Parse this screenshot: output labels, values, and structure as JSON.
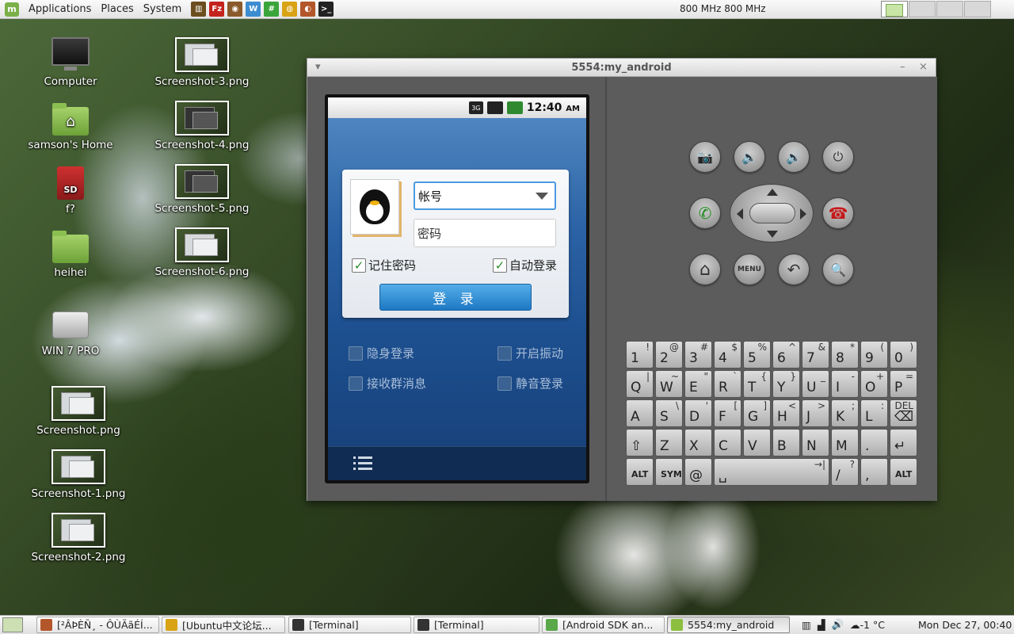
{
  "top_panel": {
    "menus": [
      "Applications",
      "Places",
      "System"
    ],
    "launchers": [
      {
        "icon": "system-monitor-icon",
        "color": "#6b4d1e",
        "glyph": "▥"
      },
      {
        "icon": "filezilla-icon",
        "color": "#c4231d",
        "glyph": "Fz"
      },
      {
        "icon": "disk-utility-icon",
        "color": "#8a5a2a",
        "glyph": "◉"
      },
      {
        "icon": "writer-icon",
        "color": "#3d8dd0",
        "glyph": "W"
      },
      {
        "icon": "calc-icon",
        "color": "#3aa53a",
        "glyph": "#"
      },
      {
        "icon": "chrome-icon",
        "color": "#d9a316",
        "glyph": "◍"
      },
      {
        "icon": "media-icon",
        "color": "#b3572b",
        "glyph": "◐"
      },
      {
        "icon": "terminal-icon",
        "color": "#222222",
        "glyph": ">_"
      }
    ],
    "cpu_freq": "800 MHz  800 MHz"
  },
  "desktop_icons": [
    {
      "label": "Computer",
      "icon": "computer-icon"
    },
    {
      "label": "samson's Home",
      "icon": "home-folder-icon"
    },
    {
      "label": "f?",
      "icon": "sd-card-icon",
      "badge": "SD"
    },
    {
      "label": "heihei",
      "icon": "folder-icon"
    },
    {
      "label": "WIN 7 PRO",
      "icon": "drive-icon"
    },
    {
      "label": "Screenshot.png",
      "icon": "image-thumbnail-icon"
    },
    {
      "label": "Screenshot-1.png",
      "icon": "image-thumbnail-icon"
    },
    {
      "label": "Screenshot-2.png",
      "icon": "image-thumbnail-icon"
    },
    {
      "label": "Screenshot-3.png",
      "icon": "image-thumbnail-icon"
    },
    {
      "label": "Screenshot-4.png",
      "icon": "image-thumbnail-icon"
    },
    {
      "label": "Screenshot-5.png",
      "icon": "image-thumbnail-icon"
    },
    {
      "label": "Screenshot-6.png",
      "icon": "image-thumbnail-icon"
    }
  ],
  "emulator": {
    "title": "5554:my_android",
    "window_menu": "▾",
    "minimize": "–",
    "close": "×",
    "status_bar": {
      "network": "3G",
      "time": "12:40",
      "ampm": "AM"
    },
    "qq": {
      "account_placeholder": "帐号",
      "password_placeholder": "密码",
      "remember_password": "记住密码",
      "auto_login": "自动登录",
      "login_button": "登 录",
      "check_mark": "✓",
      "options": [
        "隐身登录",
        "开启振动",
        "接收群消息",
        "静音登录"
      ]
    },
    "hardware_buttons": {
      "menu": "MENU",
      "camera_glyph": "📷",
      "vol_down_glyph": "🔈",
      "vol_up_glyph": "🔊",
      "power_glyph": "⏻",
      "call_glyph": "✆",
      "end_call_glyph": "☎",
      "home_glyph": "⌂",
      "back_glyph": "↶",
      "search_glyph": "🔍"
    },
    "keyboard": [
      [
        {
          "m": "1",
          "s": "!"
        },
        {
          "m": "2",
          "s": "@"
        },
        {
          "m": "3",
          "s": "#"
        },
        {
          "m": "4",
          "s": "$"
        },
        {
          "m": "5",
          "s": "%"
        },
        {
          "m": "6",
          "s": "^"
        },
        {
          "m": "7",
          "s": "&"
        },
        {
          "m": "8",
          "s": "*"
        },
        {
          "m": "9",
          "s": "("
        },
        {
          "m": "0",
          "s": ")"
        }
      ],
      [
        {
          "m": "Q",
          "s": "|"
        },
        {
          "m": "W",
          "s": "~"
        },
        {
          "m": "E",
          "s": "\""
        },
        {
          "m": "R",
          "s": "`"
        },
        {
          "m": "T",
          "s": "{"
        },
        {
          "m": "Y",
          "s": "}"
        },
        {
          "m": "U",
          "s": "_"
        },
        {
          "m": "I",
          "s": "-"
        },
        {
          "m": "O",
          "s": "+"
        },
        {
          "m": "P",
          "s": "="
        }
      ],
      [
        {
          "m": "A",
          "s": ""
        },
        {
          "m": "S",
          "s": "\\"
        },
        {
          "m": "D",
          "s": "'"
        },
        {
          "m": "F",
          "s": "["
        },
        {
          "m": "G",
          "s": "]"
        },
        {
          "m": "H",
          "s": "<"
        },
        {
          "m": "J",
          "s": ">"
        },
        {
          "m": "K",
          "s": ";"
        },
        {
          "m": "L",
          "s": ":"
        },
        {
          "m": "⌫",
          "s": "DEL"
        }
      ],
      [
        {
          "m": "⇧",
          "s": ""
        },
        {
          "m": "Z",
          "s": ""
        },
        {
          "m": "X",
          "s": ""
        },
        {
          "m": "C",
          "s": ""
        },
        {
          "m": "V",
          "s": ""
        },
        {
          "m": "B",
          "s": ""
        },
        {
          "m": "N",
          "s": ""
        },
        {
          "m": "M",
          "s": ""
        },
        {
          "m": ".",
          "s": ""
        },
        {
          "m": "↵",
          "s": ""
        }
      ],
      [
        {
          "m": "ALT",
          "s": ""
        },
        {
          "m": "SYM",
          "s": ""
        },
        {
          "m": "@",
          "s": ""
        },
        {
          "m": "␣",
          "s": "→|"
        },
        {
          "m": "/",
          "s": "?"
        },
        {
          "m": ",",
          "s": ""
        },
        {
          "m": "ALT",
          "s": ""
        }
      ]
    ]
  },
  "taskbar": {
    "tasks": [
      {
        "label": "[²ÂÞÈÑ¸ - ÔÙÃãÉÍ...",
        "icon": "app-icon",
        "color": "#b3572b"
      },
      {
        "label": "[Ubuntu中文论坛...",
        "icon": "chrome-icon",
        "color": "#d9a316"
      },
      {
        "label": "[Terminal]",
        "icon": "terminal-icon",
        "color": "#333333"
      },
      {
        "label": "[Terminal]",
        "icon": "terminal-icon",
        "color": "#333333"
      },
      {
        "label": "[Android SDK an...",
        "icon": "download-icon",
        "color": "#5aa84a"
      },
      {
        "label": "5554:my_android",
        "icon": "android-icon",
        "color": "#8cbf3f"
      }
    ],
    "tray": {
      "weather": "-1 °C"
    },
    "clock": "Mon Dec 27, 00:40"
  }
}
